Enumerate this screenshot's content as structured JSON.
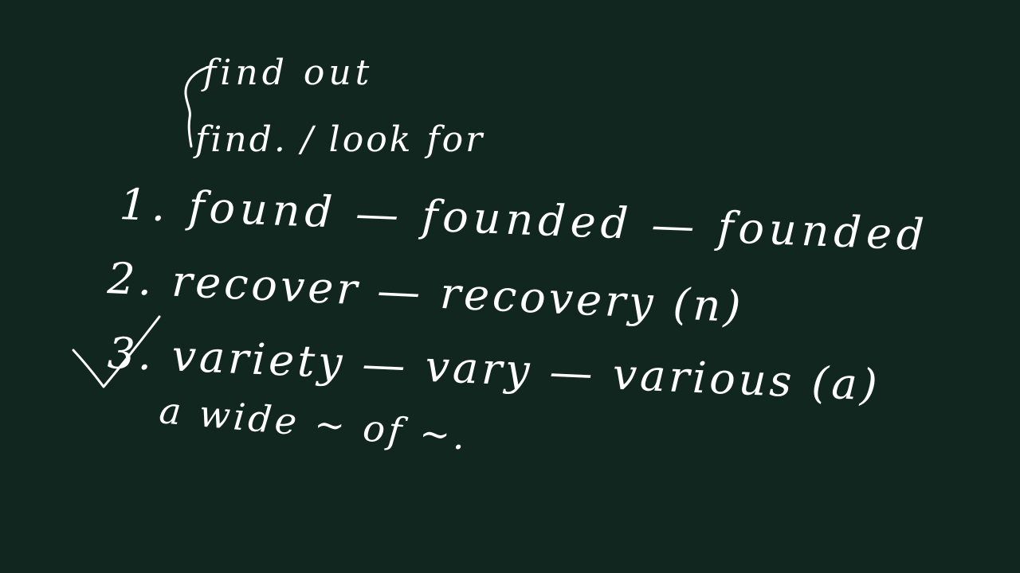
{
  "board": {
    "background_color": "#11261f",
    "ink_color": "#ffffff",
    "lines": [
      "find out",
      "find. / look for",
      "1. found — founded — founded",
      "2. recover — recovery (n)",
      "3. variety — vary — various (a)",
      "a wide ~ of ~."
    ],
    "marks": [
      "brace-icon",
      "checkmark-icon"
    ]
  }
}
